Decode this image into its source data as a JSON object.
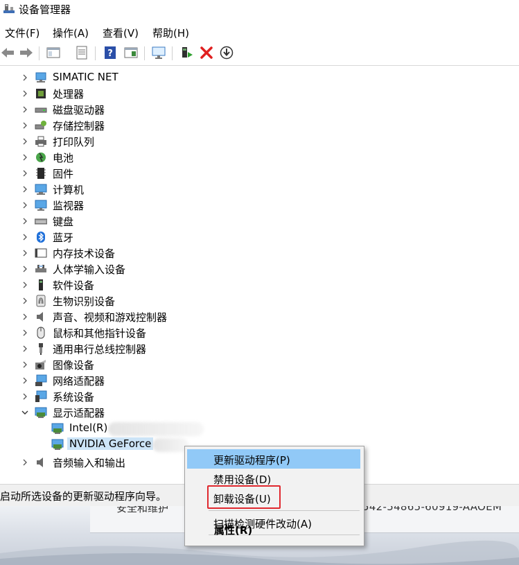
{
  "window": {
    "title": "设备管理器"
  },
  "menu": [
    {
      "label": "文件(F)"
    },
    {
      "label": "操作(A)"
    },
    {
      "label": "查看(V)"
    },
    {
      "label": "帮助(H)"
    }
  ],
  "toolbar": [
    {
      "icon": "back-arrow-icon"
    },
    {
      "icon": "forward-arrow-icon"
    },
    {
      "icon": "show-hide-console-tree-icon"
    },
    {
      "icon": "properties-icon"
    },
    {
      "icon": "help-icon"
    },
    {
      "icon": "show-action-pane-icon"
    },
    {
      "icon": "scan-hardware-icon"
    },
    {
      "icon": "update-driver-icon"
    },
    {
      "icon": "uninstall-device-icon"
    },
    {
      "icon": "download-icon"
    }
  ],
  "tree": {
    "categories": [
      {
        "label": "SIMATIC NET",
        "icon": "network-monitor-icon"
      },
      {
        "label": "处理器",
        "icon": "processor-icon"
      },
      {
        "label": "磁盘驱动器",
        "icon": "disk-drive-icon"
      },
      {
        "label": "存储控制器",
        "icon": "storage-controller-icon"
      },
      {
        "label": "打印队列",
        "icon": "printer-icon"
      },
      {
        "label": "电池",
        "icon": "battery-icon"
      },
      {
        "label": "固件",
        "icon": "firmware-icon"
      },
      {
        "label": "计算机",
        "icon": "computer-icon"
      },
      {
        "label": "监视器",
        "icon": "monitor-icon"
      },
      {
        "label": "键盘",
        "icon": "keyboard-icon"
      },
      {
        "label": "蓝牙",
        "icon": "bluetooth-icon"
      },
      {
        "label": "内存技术设备",
        "icon": "memory-device-icon"
      },
      {
        "label": "人体学输入设备",
        "icon": "hid-icon"
      },
      {
        "label": "软件设备",
        "icon": "software-device-icon"
      },
      {
        "label": "生物识别设备",
        "icon": "fingerprint-icon"
      },
      {
        "label": "声音、视频和游戏控制器",
        "icon": "speaker-icon"
      },
      {
        "label": "鼠标和其他指针设备",
        "icon": "mouse-icon"
      },
      {
        "label": "通用串行总线控制器",
        "icon": "usb-icon"
      },
      {
        "label": "图像设备",
        "icon": "camera-icon"
      },
      {
        "label": "网络适配器",
        "icon": "network-adapter-icon"
      },
      {
        "label": "系统设备",
        "icon": "system-device-icon"
      },
      {
        "label": "显示适配器",
        "icon": "display-adapter-icon"
      },
      {
        "label": "音频输入和输出",
        "icon": "audio-io-icon"
      }
    ],
    "display_children": [
      {
        "label": "Intel(R)",
        "icon": "display-adapter-icon"
      },
      {
        "label": "NVIDIA GeForce",
        "icon": "display-adapter-icon"
      }
    ]
  },
  "status": {
    "text": "启动所选设备的更新驱动程序向导。"
  },
  "background_window": {
    "left_text": "安全和维护",
    "right_text": "542-54865-60919-AAOEM"
  },
  "context_menu": {
    "items": [
      {
        "label": "更新驱动程序(P)"
      },
      {
        "label": "禁用设备(D)"
      },
      {
        "label": "卸载设备(U)"
      },
      {
        "label": "扫描检测硬件改动(A)"
      },
      {
        "label": "属性(R)"
      }
    ]
  },
  "colors": {
    "highlight": "#91c9f7",
    "selection": "#cce4f7",
    "annotation_red": "#e0282e",
    "uninstall_red": "#e02020"
  }
}
